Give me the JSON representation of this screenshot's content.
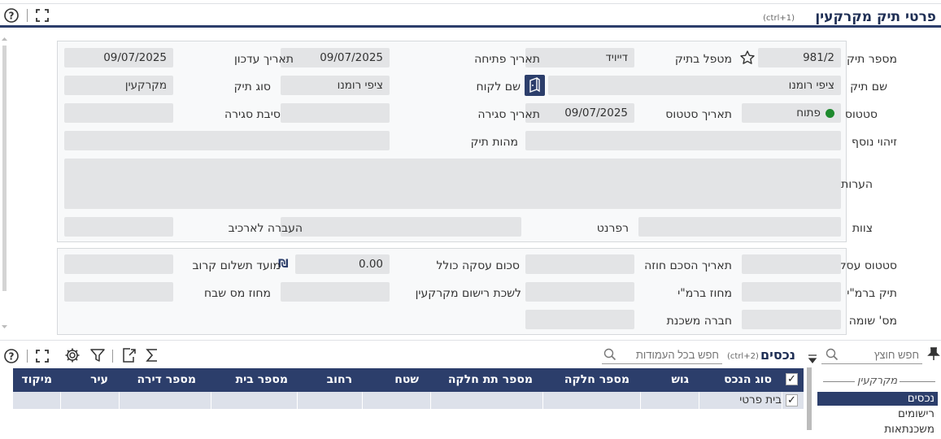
{
  "header": {
    "title": "פרטי תיק מקרקעין",
    "shortcut": "(ctrl+1)"
  },
  "form": {
    "file_number_label": "מספר תיק",
    "file_number_value": "981/2",
    "handler_label": "מטפל בתיק",
    "handler_value": "דייויד",
    "open_date_label": "תאריך פתיחה",
    "open_date_value": "09/07/2025",
    "update_date_label": "תאריך עדכון",
    "update_date_value": "09/07/2025",
    "file_name_label": "שם תיק",
    "file_name_value": "ציפי רומנו",
    "client_name_label": "שם לקוח",
    "client_name_value": "ציפי רומנו",
    "file_type_label": "סוג תיק",
    "file_type_value": "מקרקעין",
    "status_label": "סטטוס",
    "status_value": "פתוח",
    "status_color": "#1e8a2e",
    "status_date_label": "תאריך סטטוס",
    "status_date_value": "09/07/2025",
    "close_date_label": "תאריך סגירה",
    "close_date_value": "",
    "close_reason_label": "סיבת סגירה",
    "close_reason_value": "",
    "extra_id_label": "זיהוי נוסף",
    "extra_id_value": "",
    "file_nature_label": "מהות תיק",
    "file_nature_value": "",
    "notes_label": "הערות",
    "notes_value": "",
    "team_label": "צוות",
    "team_value": "",
    "referent_label": "רפרנט",
    "referent_value": "",
    "archive_label": "העברה לארכיב",
    "archive_value": ""
  },
  "deal": {
    "deal_status_label": "סטטוס עסקה",
    "deal_status_value": "",
    "contract_date_label": "תאריך הסכם חוזה",
    "contract_date_value": "",
    "total_label": "סכום עסקה כולל",
    "total_value": "0.00",
    "currency_symbol": "₪",
    "next_payment_label": "מועד תשלום קרוב",
    "next_payment_value": "",
    "rmi_file_label": "תיק ברמ\"י",
    "rmi_file_value": "",
    "rmi_district_label": "מחוז ברמ\"י",
    "rmi_district_value": "",
    "registry_label": "לשכת רישום מקרקעין",
    "registry_value": "",
    "tax_district_label": "מחוז מס שבח",
    "tax_district_value": "",
    "appraiser_label": "מס' שומה",
    "appraiser_value": "",
    "mortgage_co_label": "חברה משכנת",
    "mortgage_co_value": ""
  },
  "assets": {
    "title": "נכסים",
    "search_shortcut": "(ctrl+2)",
    "search_placeholder": "חפש בכל העמודות",
    "columns": [
      "סוג הנכס",
      "גוש",
      "מספר חלקה",
      "מספר תת חלקה",
      "שטח",
      "רחוב",
      "מספר בית",
      "מספר דירה",
      "עיר",
      "מיקוד"
    ],
    "rows": [
      {
        "checked": "✓",
        "asset_type": "בית פרטי"
      }
    ]
  },
  "side": {
    "search_placeholder": "חפש חוצץ",
    "group": "מקרקעין",
    "items": [
      "נכסים",
      "רישומים",
      "משכנתאות"
    ]
  },
  "colors": {
    "accent": "#2c3e6b",
    "field_bg": "#e3e4e6"
  }
}
